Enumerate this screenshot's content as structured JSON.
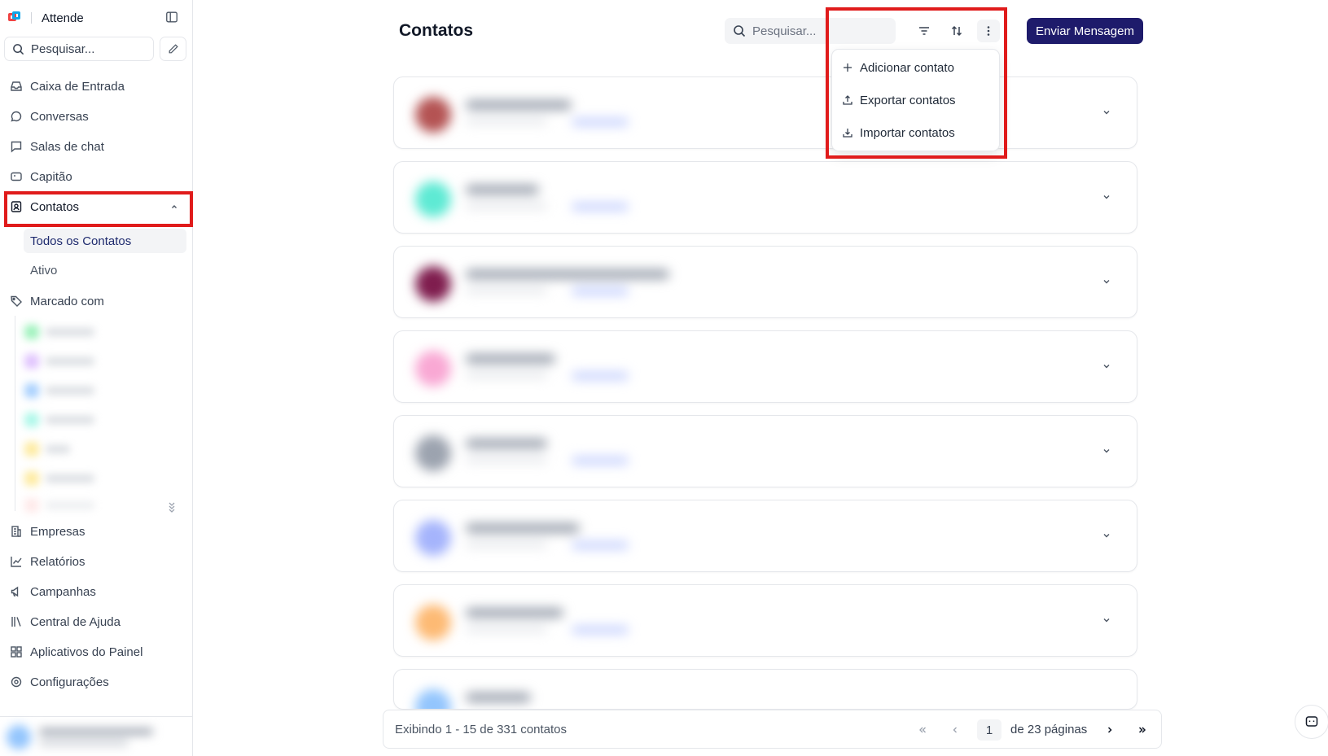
{
  "app": {
    "name": "Attende"
  },
  "sidebar": {
    "search_placeholder": "Pesquisar...",
    "items": [
      {
        "label": "Caixa de Entrada",
        "icon": "inbox-icon"
      },
      {
        "label": "Conversas",
        "icon": "chat-bubble-icon"
      },
      {
        "label": "Salas de chat",
        "icon": "message-square-icon"
      },
      {
        "label": "Capitão",
        "icon": "captain-icon"
      },
      {
        "label": "Contatos",
        "icon": "contact-book-icon",
        "expanded": true
      },
      {
        "label": "Marcado com",
        "icon": "tag-icon"
      },
      {
        "label": "Empresas",
        "icon": "building-icon"
      },
      {
        "label": "Relatórios",
        "icon": "chart-line-icon"
      },
      {
        "label": "Campanhas",
        "icon": "megaphone-icon"
      },
      {
        "label": "Central de Ajuda",
        "icon": "library-icon"
      },
      {
        "label": "Aplicativos do Painel",
        "icon": "apps-grid-icon"
      },
      {
        "label": "Configurações",
        "icon": "settings-icon"
      }
    ],
    "contacts_subitems": [
      {
        "label": "Todos os Contatos",
        "selected": true
      },
      {
        "label": "Ativo",
        "selected": false
      }
    ]
  },
  "header": {
    "title": "Contatos",
    "search_placeholder": "Pesquisar...",
    "send_button": "Enviar Mensagem"
  },
  "menu": {
    "items": [
      {
        "label": "Adicionar contato",
        "icon": "plus-icon"
      },
      {
        "label": "Exportar contatos",
        "icon": "upload-icon"
      },
      {
        "label": "Importar contatos",
        "icon": "download-icon"
      }
    ]
  },
  "footer": {
    "info": "Exibindo 1 - 15 de 331 contatos",
    "current_page": "1",
    "of_pages": "de 23 páginas"
  },
  "colors": {
    "primary": "#1e1b6b",
    "highlight": "#e01b1b",
    "avatar_colors": [
      "#b45353",
      "#5eead4",
      "#7f1d4e",
      "#f9a8d4",
      "#9ca3af",
      "#a5b4fc",
      "#fdba74",
      "#93c5fd"
    ]
  }
}
